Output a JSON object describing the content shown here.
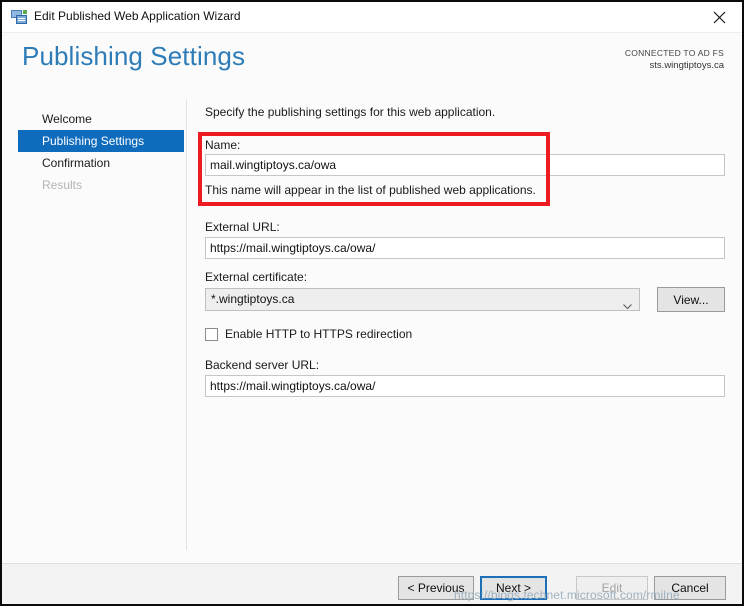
{
  "window": {
    "title": "Edit Published Web Application Wizard",
    "icon": "wizard-icon",
    "close_label": "✕"
  },
  "header": {
    "title": "Publishing Settings",
    "connected_label": "CONNECTED TO AD FS",
    "connected_host": "sts.wingtiptoys.ca",
    "accent_color": "#2d7cb8"
  },
  "sidebar": {
    "items": [
      {
        "label": "Welcome",
        "state": "normal"
      },
      {
        "label": "Publishing Settings",
        "state": "selected"
      },
      {
        "label": "Confirmation",
        "state": "normal"
      },
      {
        "label": "Results",
        "state": "disabled"
      }
    ],
    "selected_color": "#0f6cbd"
  },
  "main": {
    "intro": "Specify the publishing settings for this web application.",
    "name_field": {
      "label": "Name:",
      "value": "mail.wingtiptoys.ca/owa",
      "placeholder": "",
      "helper": "This name will appear in the list of published web applications."
    },
    "external_url_field": {
      "label": "External URL:",
      "value": "https://mail.wingtiptoys.ca/owa/",
      "placeholder": ""
    },
    "external_certificate_field": {
      "label": "External certificate:",
      "value": "*.wingtiptoys.ca",
      "view_button": "View..."
    },
    "redirect_checkbox": {
      "label": "Enable HTTP to HTTPS redirection",
      "checked": false
    },
    "backend_url_field": {
      "label": "Backend server URL:",
      "value": "https://mail.wingtiptoys.ca/owa/",
      "placeholder": ""
    }
  },
  "annotation": {
    "color": "#ee1c22"
  },
  "footer": {
    "previous_label": "< Previous",
    "next_label": "Next >",
    "edit_label": "Edit",
    "cancel_label": "Cancel"
  },
  "watermark": {
    "text": "https://blogs.technet.microsoft.com/rmilne"
  }
}
